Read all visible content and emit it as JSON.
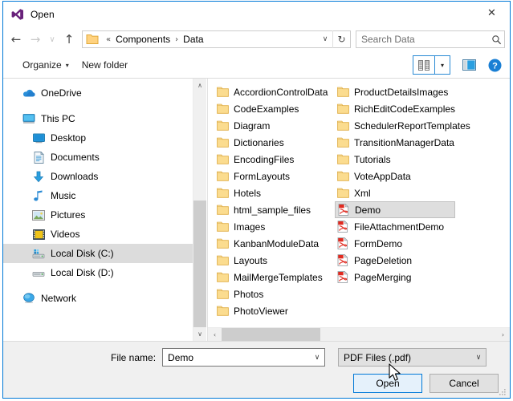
{
  "window": {
    "title": "Open",
    "app_icon": "visual-studio-icon",
    "close_label": "✕",
    "border_color": "#0078d7"
  },
  "nav": {
    "back_label": "←",
    "forward_label": "→",
    "recent_label": "∨",
    "up_label": "↑",
    "address": {
      "folder_icon": "folder-icon",
      "prefix": "«",
      "crumbs": [
        "Components",
        "Data"
      ],
      "separator": "›",
      "dropdown_label": "∨"
    },
    "refresh_label": "↻",
    "search": {
      "placeholder": "Search Data",
      "value": "",
      "icon": "search-icon"
    }
  },
  "toolbar": {
    "organize_label": "Organize",
    "organize_caret": "▾",
    "new_folder_label": "New folder",
    "view_icon": "list-view-icon",
    "view_caret": "▾",
    "preview_pane_icon": "preview-pane-icon",
    "help_icon": "help-icon",
    "accent_color": "#2a8ad4"
  },
  "sidebar": {
    "groups": [
      {
        "items": [
          {
            "label": "OneDrive",
            "icon": "onedrive-cloud-icon",
            "indent": false,
            "selected": false
          }
        ]
      },
      {
        "items": [
          {
            "label": "This PC",
            "icon": "this-pc-icon",
            "indent": false,
            "selected": false
          },
          {
            "label": "Desktop",
            "icon": "desktop-icon",
            "indent": true,
            "selected": false
          },
          {
            "label": "Documents",
            "icon": "documents-icon",
            "indent": true,
            "selected": false
          },
          {
            "label": "Downloads",
            "icon": "downloads-icon",
            "indent": true,
            "selected": false
          },
          {
            "label": "Music",
            "icon": "music-icon",
            "indent": true,
            "selected": false
          },
          {
            "label": "Pictures",
            "icon": "pictures-icon",
            "indent": true,
            "selected": false
          },
          {
            "label": "Videos",
            "icon": "videos-icon",
            "indent": true,
            "selected": false
          },
          {
            "label": "Local Disk (C:)",
            "icon": "local-disk-c-icon",
            "indent": true,
            "selected": true
          },
          {
            "label": "Local Disk (D:)",
            "icon": "local-disk-d-icon",
            "indent": true,
            "selected": false
          }
        ]
      },
      {
        "items": [
          {
            "label": "Network",
            "icon": "network-icon",
            "indent": false,
            "selected": false
          }
        ]
      }
    ],
    "scrollbar": {
      "up_label": "∧",
      "down_label": "∨"
    }
  },
  "files": {
    "items": [
      {
        "name": "AccordionControlData",
        "type": "folder",
        "selected": false
      },
      {
        "name": "CodeExamples",
        "type": "folder",
        "selected": false
      },
      {
        "name": "Diagram",
        "type": "folder",
        "selected": false
      },
      {
        "name": "Dictionaries",
        "type": "folder",
        "selected": false
      },
      {
        "name": "EncodingFiles",
        "type": "folder",
        "selected": false
      },
      {
        "name": "FormLayouts",
        "type": "folder",
        "selected": false
      },
      {
        "name": "Hotels",
        "type": "folder",
        "selected": false
      },
      {
        "name": "html_sample_files",
        "type": "folder",
        "selected": false
      },
      {
        "name": "Images",
        "type": "folder",
        "selected": false
      },
      {
        "name": "KanbanModuleData",
        "type": "folder",
        "selected": false
      },
      {
        "name": "Layouts",
        "type": "folder",
        "selected": false
      },
      {
        "name": "MailMergeTemplates",
        "type": "folder",
        "selected": false
      },
      {
        "name": "Photos",
        "type": "folder",
        "selected": false
      },
      {
        "name": "PhotoViewer",
        "type": "folder",
        "selected": false
      },
      {
        "name": "ProductDetailsImages",
        "type": "folder",
        "selected": false
      },
      {
        "name": "RichEditCodeExamples",
        "type": "folder",
        "selected": false
      },
      {
        "name": "SchedulerReportTemplates",
        "type": "folder",
        "selected": false
      },
      {
        "name": "TransitionManagerData",
        "type": "folder",
        "selected": false
      },
      {
        "name": "Tutorials",
        "type": "folder",
        "selected": false
      },
      {
        "name": "VoteAppData",
        "type": "folder",
        "selected": false
      },
      {
        "name": "Xml",
        "type": "folder",
        "selected": false
      },
      {
        "name": "Demo",
        "type": "pdf",
        "selected": true
      },
      {
        "name": "FileAttachmentDemo",
        "type": "pdf",
        "selected": false
      },
      {
        "name": "FormDemo",
        "type": "pdf",
        "selected": false
      },
      {
        "name": "PageDeletion",
        "type": "pdf",
        "selected": false
      },
      {
        "name": "PageMerging",
        "type": "pdf",
        "selected": false
      }
    ],
    "hscrollbar": {
      "left_label": "‹",
      "right_label": "›"
    }
  },
  "footer": {
    "file_name_label": "File name:",
    "file_name_value": "Demo",
    "file_name_caret": "∨",
    "filter_value": "PDF Files (.pdf)",
    "filter_caret": "∨",
    "open_label": "Open",
    "cancel_label": "Cancel",
    "resize_grip": "resize-grip-icon"
  }
}
